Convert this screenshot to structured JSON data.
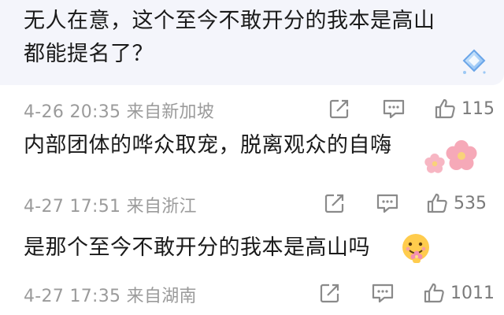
{
  "comments": [
    {
      "text_line1": "无人在意，这个至今不敢开分的我本是高山",
      "text_line2": "都能提名了？",
      "date": "4-26",
      "time": "20:35",
      "location": "来自新加坡",
      "likes": "115",
      "decoration_icon": "diamond-badge-icon"
    },
    {
      "text_line1": "内部团体的哗众取宠，脱离观众的自嗨",
      "date": "4-27",
      "time": "17:51",
      "location": "来自浙江",
      "likes": "535",
      "decoration_icon": "cherry-blossom-icon"
    },
    {
      "text_line1": "是那个至今不敢开分的我本是高山吗",
      "date": "4-27",
      "time": "17:35",
      "location": "来自湖南",
      "likes": "1011",
      "decoration_icon": "flower-face-emoji-icon"
    }
  ],
  "actions": {
    "share_icon": "share-icon",
    "comment_icon": "comment-icon",
    "like_icon": "thumbs-up-icon"
  },
  "colors": {
    "text": "#1a1a1a",
    "meta": "#9b9b9b",
    "bubble_bg": "#f4f5fb",
    "blossom": "#f6a9b8"
  }
}
